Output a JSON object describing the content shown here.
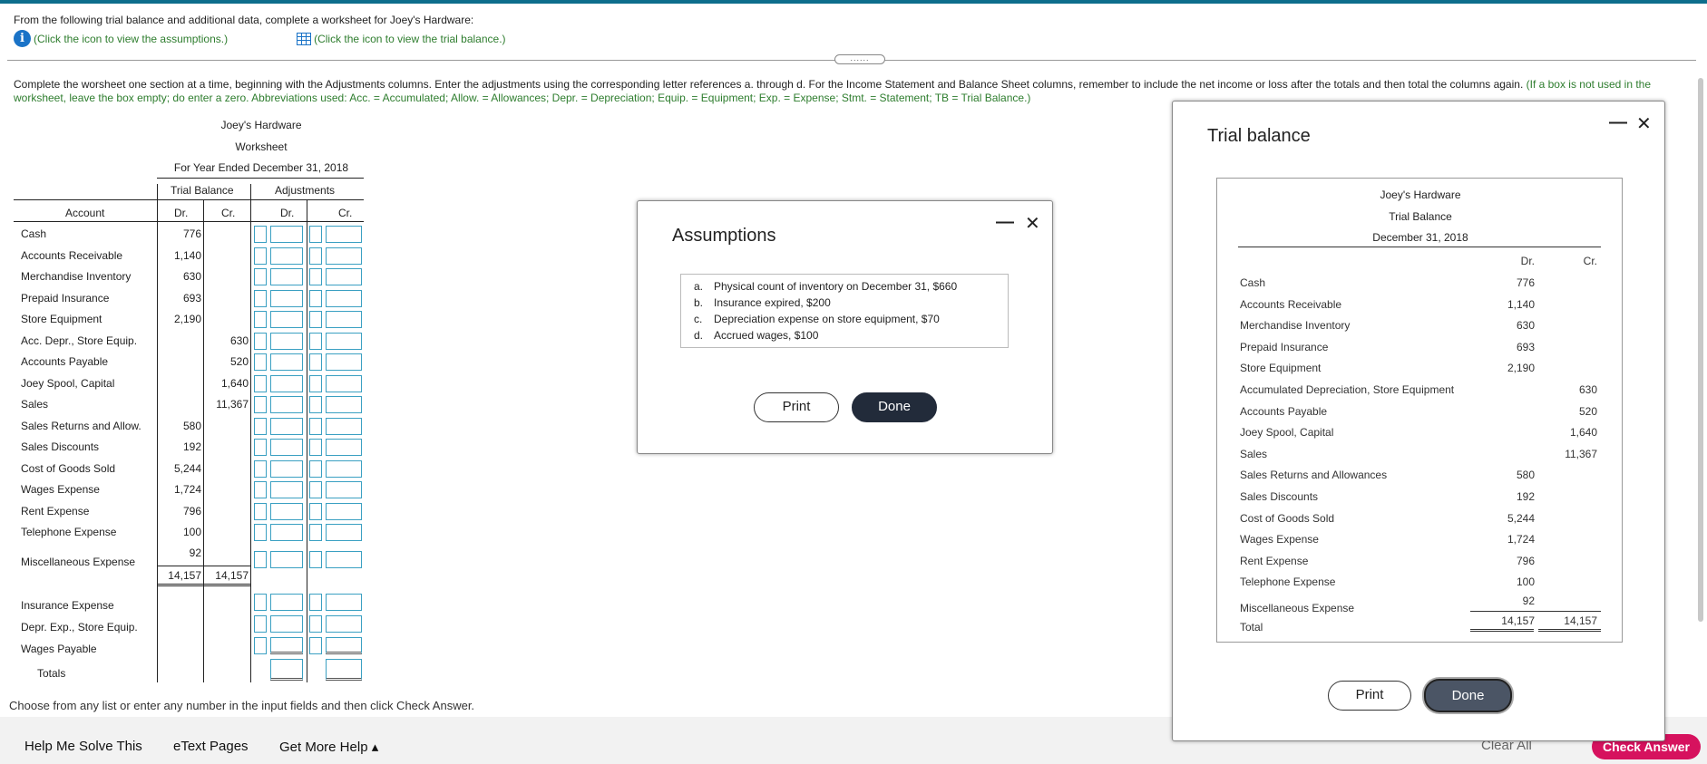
{
  "header": {
    "intro": "From the following trial balance and additional data, complete a worksheet for Joey's Hardware:",
    "assumptions_link": "(Click the icon to view the assumptions.)",
    "trial_balance_link": "(Click the icon to view the trial balance.)",
    "handle": "......"
  },
  "instructions": {
    "main": "Complete the worsheet one section at a time, beginning with the Adjustments columns. Enter the adjustments using the corresponding letter references a. through d. For the Income Statement and Balance Sheet columns, remember to include the net income or loss after the totals and then total the columns again. ",
    "green": "(If a box is not used in the worksheet, leave the box empty; do enter a zero. Abbreviations used: Acc. = Accumulated; Allow. = Allowances; Depr. = Depreciation; Equip. = Equipment; Exp. = Expense; Stmt. = Statement; TB = Trial Balance.)"
  },
  "worksheet": {
    "company": "Joey's Hardware",
    "title": "Worksheet",
    "period": "For Year Ended December 31, 2018",
    "group_tb": "Trial Balance",
    "group_adj": "Adjustments",
    "col_account": "Account",
    "col_dr": "Dr.",
    "col_cr": "Cr.",
    "rows": [
      {
        "account": "Cash",
        "dr": "776",
        "cr": ""
      },
      {
        "account": "Accounts Receivable",
        "dr": "1,140",
        "cr": ""
      },
      {
        "account": "Merchandise Inventory",
        "dr": "630",
        "cr": ""
      },
      {
        "account": "Prepaid Insurance",
        "dr": "693",
        "cr": ""
      },
      {
        "account": "Store Equipment",
        "dr": "2,190",
        "cr": ""
      },
      {
        "account": "Acc. Depr., Store Equip.",
        "dr": "",
        "cr": "630"
      },
      {
        "account": "Accounts Payable",
        "dr": "",
        "cr": "520"
      },
      {
        "account": "Joey Spool, Capital",
        "dr": "",
        "cr": "1,640"
      },
      {
        "account": "Sales",
        "dr": "",
        "cr": "11,367"
      },
      {
        "account": "Sales Returns and Allow.",
        "dr": "580",
        "cr": ""
      },
      {
        "account": "Sales Discounts",
        "dr": "192",
        "cr": ""
      },
      {
        "account": "Cost of Goods Sold",
        "dr": "5,244",
        "cr": ""
      },
      {
        "account": "Wages Expense",
        "dr": "1,724",
        "cr": ""
      },
      {
        "account": "Rent Expense",
        "dr": "796",
        "cr": ""
      },
      {
        "account": "Telephone Expense",
        "dr": "100",
        "cr": ""
      },
      {
        "account": "Miscellaneous Expense",
        "dr": "92",
        "cr": ""
      }
    ],
    "total_dr": "14,157",
    "total_cr": "14,157",
    "extra_rows": [
      {
        "account": "Insurance Expense"
      },
      {
        "account": "Depr. Exp., Store Equip."
      },
      {
        "account": "Wages Payable"
      }
    ],
    "totals_label": "Totals"
  },
  "footer": {
    "choose": "Choose from any list or enter any number in the input fields and then click Check Answer.",
    "help": "Help Me Solve This",
    "etext": "eText Pages",
    "more_help": "Get More Help ▴",
    "clear_all": "Clear All",
    "check": "Check Answer"
  },
  "assumptions_modal": {
    "title": "Assumptions",
    "items": [
      {
        "letter": "a.",
        "text": "Physical count of inventory on December 31, $660"
      },
      {
        "letter": "b.",
        "text": "Insurance expired, $200"
      },
      {
        "letter": "c.",
        "text": "Depreciation expense on store equipment, $70"
      },
      {
        "letter": "d.",
        "text": "Accrued wages, $100"
      }
    ],
    "print": "Print",
    "done": "Done",
    "minimize": "—",
    "close": "✕"
  },
  "tb_modal": {
    "title": "Trial balance",
    "company": "Joey's Hardware",
    "subtitle": "Trial Balance",
    "date": "December 31, 2018",
    "col_dr": "Dr.",
    "col_cr": "Cr.",
    "rows": [
      {
        "account": "Cash",
        "dr": "776",
        "cr": ""
      },
      {
        "account": "Accounts Receivable",
        "dr": "1,140",
        "cr": ""
      },
      {
        "account": "Merchandise Inventory",
        "dr": "630",
        "cr": ""
      },
      {
        "account": "Prepaid Insurance",
        "dr": "693",
        "cr": ""
      },
      {
        "account": "Store Equipment",
        "dr": "2,190",
        "cr": ""
      },
      {
        "account": "Accumulated Depreciation, Store Equipment",
        "dr": "",
        "cr": "630"
      },
      {
        "account": "Accounts Payable",
        "dr": "",
        "cr": "520"
      },
      {
        "account": "Joey Spool, Capital",
        "dr": "",
        "cr": "1,640"
      },
      {
        "account": "Sales",
        "dr": "",
        "cr": "11,367"
      },
      {
        "account": "Sales Returns and Allowances",
        "dr": "580",
        "cr": ""
      },
      {
        "account": "Sales Discounts",
        "dr": "192",
        "cr": ""
      },
      {
        "account": "Cost of Goods Sold",
        "dr": "5,244",
        "cr": ""
      },
      {
        "account": "Wages Expense",
        "dr": "1,724",
        "cr": ""
      },
      {
        "account": "Rent Expense",
        "dr": "796",
        "cr": ""
      },
      {
        "account": "Telephone Expense",
        "dr": "100",
        "cr": ""
      },
      {
        "account": "Miscellaneous Expense",
        "dr": "92",
        "cr": ""
      }
    ],
    "total_label": "Total",
    "total_dr": "14,157",
    "total_cr": "14,157",
    "print": "Print",
    "done": "Done",
    "minimize": "—",
    "close": "✕"
  }
}
